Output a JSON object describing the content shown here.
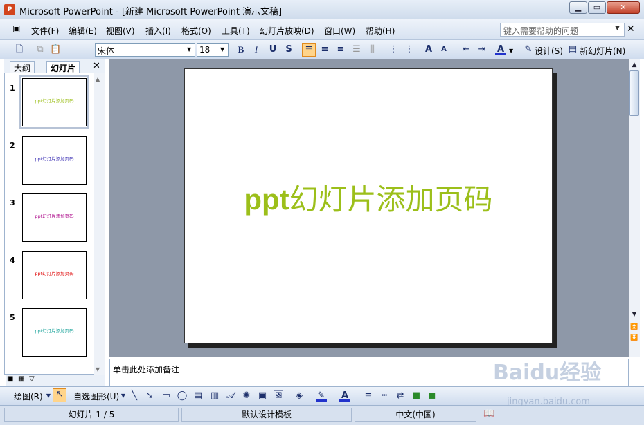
{
  "window": {
    "title": "Microsoft PowerPoint - [新建 Microsoft PowerPoint 演示文稿]",
    "app_icon": "P"
  },
  "menu": {
    "items": [
      "文件(F)",
      "编辑(E)",
      "视图(V)",
      "插入(I)",
      "格式(O)",
      "工具(T)",
      "幻灯片放映(D)",
      "窗口(W)",
      "帮助(H)"
    ],
    "help_placeholder": "键入需要帮助的问题"
  },
  "toolbar": {
    "font_name": "宋体",
    "font_size": "18",
    "bold": "B",
    "italic": "I",
    "underline": "U",
    "shadow": "S",
    "design_label": "设计(S)",
    "new_slide_label": "新幻灯片(N)"
  },
  "left_pane": {
    "tabs": [
      "大纲",
      "幻灯片"
    ],
    "active_tab": "幻灯片",
    "thumbnails": [
      {
        "num": "1",
        "text": "ppt幻灯片添加页码",
        "color": "#9cbf1a"
      },
      {
        "num": "2",
        "text": "ppt幻灯片添加页码",
        "color": "#3b2fb3"
      },
      {
        "num": "3",
        "text": "ppt幻灯片添加页码",
        "color": "#b0148f"
      },
      {
        "num": "4",
        "text": "ppt幻灯片添加页码",
        "color": "#e01010"
      },
      {
        "num": "5",
        "text": "ppt幻灯片添加页码",
        "color": "#1aa39a"
      }
    ]
  },
  "slide": {
    "title_latin": "ppt",
    "title_rest": "幻灯片添加页码",
    "title_color": "#9cbf1a"
  },
  "notes": {
    "placeholder": "单击此处添加备注"
  },
  "draw_toolbar": {
    "draw_label": "绘图(R)",
    "autoshape_label": "自选图形(U)"
  },
  "status": {
    "slide_position": "幻灯片 1 / 5",
    "template": "默认设计模板",
    "language": "中文(中国)"
  },
  "watermark": {
    "brand": "Baidu经验",
    "url": "jingyan.baidu.com"
  }
}
